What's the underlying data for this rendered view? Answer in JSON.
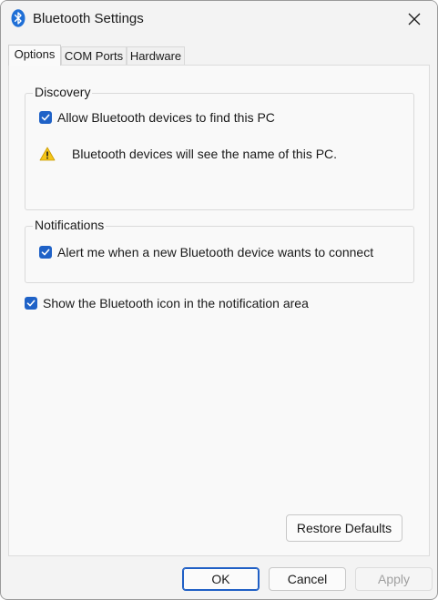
{
  "window": {
    "title": "Bluetooth Settings",
    "icon": "bluetooth-icon",
    "accent_color": "#1f62c7"
  },
  "tabs": [
    {
      "label": "Options",
      "active": true
    },
    {
      "label": "COM Ports",
      "active": false
    },
    {
      "label": "Hardware",
      "active": false
    }
  ],
  "discovery": {
    "legend": "Discovery",
    "allow_find_label": "Allow Bluetooth devices to find this PC",
    "allow_find_checked": true,
    "warning_text": "Bluetooth devices will see the name of this PC.",
    "warning_icon": "warning-icon"
  },
  "notifications": {
    "legend": "Notifications",
    "alert_label": "Alert me when a new Bluetooth device wants to connect",
    "alert_checked": true
  },
  "show_icon": {
    "label": "Show the Bluetooth icon in the notification area",
    "checked": true
  },
  "buttons": {
    "restore_defaults": "Restore Defaults",
    "ok": "OK",
    "cancel": "Cancel",
    "apply": "Apply"
  }
}
